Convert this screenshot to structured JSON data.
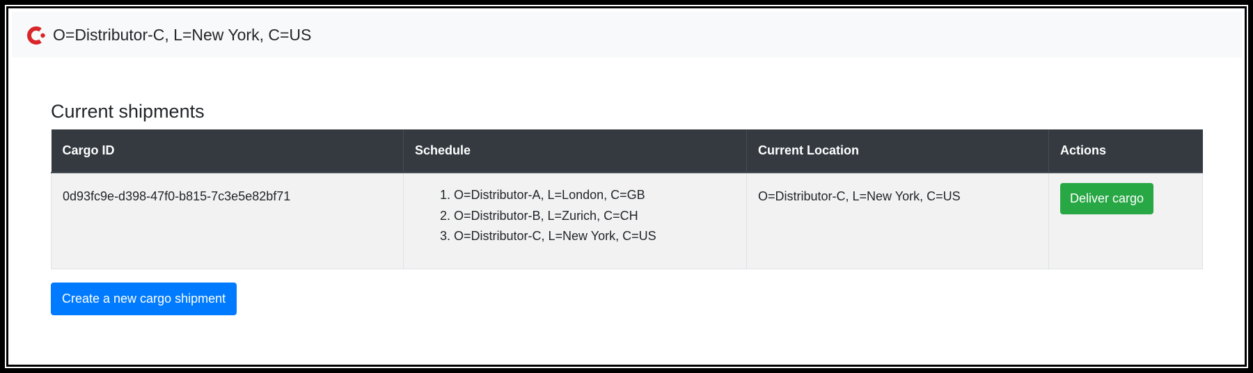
{
  "navbar": {
    "logo_icon": "corda-logo-icon",
    "title": "O=Distributor-C, L=New York, C=US",
    "brand_color": "#d9262b"
  },
  "main": {
    "section_title": "Current shipments",
    "table": {
      "headers": [
        "Cargo ID",
        "Schedule",
        "Current Location",
        "Actions"
      ],
      "rows": [
        {
          "cargo_id": "0d93fc9e-d398-47f0-b815-7c3e5e82bf71",
          "schedule": [
            "O=Distributor-A, L=London, C=GB",
            "O=Distributor-B, L=Zurich, C=CH",
            "O=Distributor-C, L=New York, C=US"
          ],
          "current_location": "O=Distributor-C, L=New York, C=US",
          "action_label": "Deliver cargo"
        }
      ]
    },
    "create_button_label": "Create a new cargo shipment"
  },
  "colors": {
    "header_bg": "#343a40",
    "success": "#28a745",
    "primary": "#007bff",
    "navbar_bg": "#f8f9fa"
  }
}
